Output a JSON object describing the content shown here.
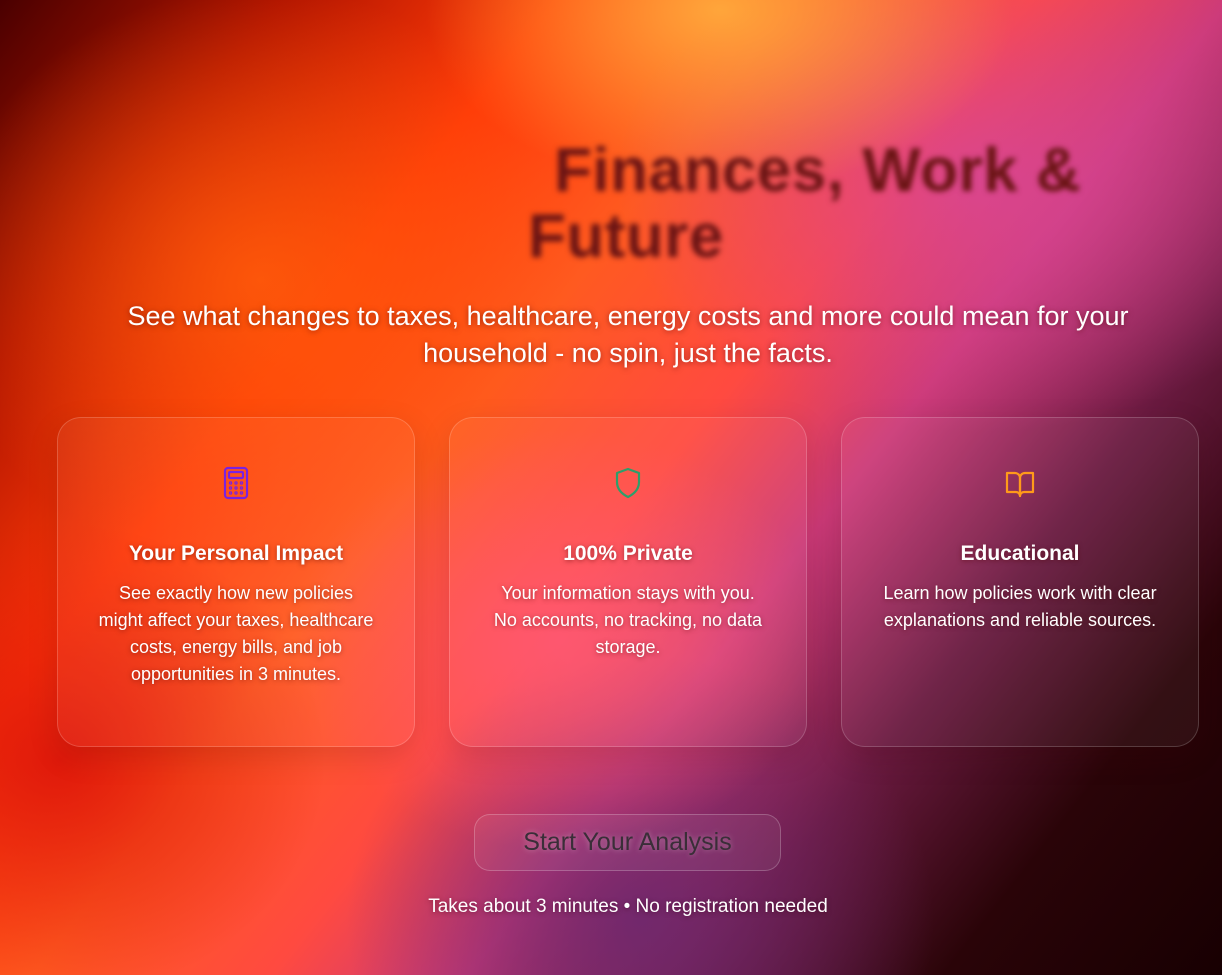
{
  "hero": {
    "title": "Finances, Work & Future",
    "subtitle": "See what changes to taxes, healthcare, energy costs and more could mean for your household - no spin, just the facts."
  },
  "features": [
    {
      "icon": "calculator-icon",
      "icon_color": "#7a22e0",
      "title": "Your Personal Impact",
      "text": "See exactly how new policies might affect your taxes, healthcare costs, energy bills, and job opportunities in 3 minutes."
    },
    {
      "icon": "shield-icon",
      "icon_color": "#2e9e6a",
      "title": "100% Private",
      "text": "Your information stays with you. No accounts, no tracking, no data storage."
    },
    {
      "icon": "book-open-icon",
      "icon_color": "#ff9a1a",
      "title": "Educational",
      "text": "Learn how policies work with clear explanations and reliable sources."
    }
  ],
  "cta": {
    "label": "Start Your Analysis",
    "note": "Takes about 3 minutes • No registration needed"
  }
}
